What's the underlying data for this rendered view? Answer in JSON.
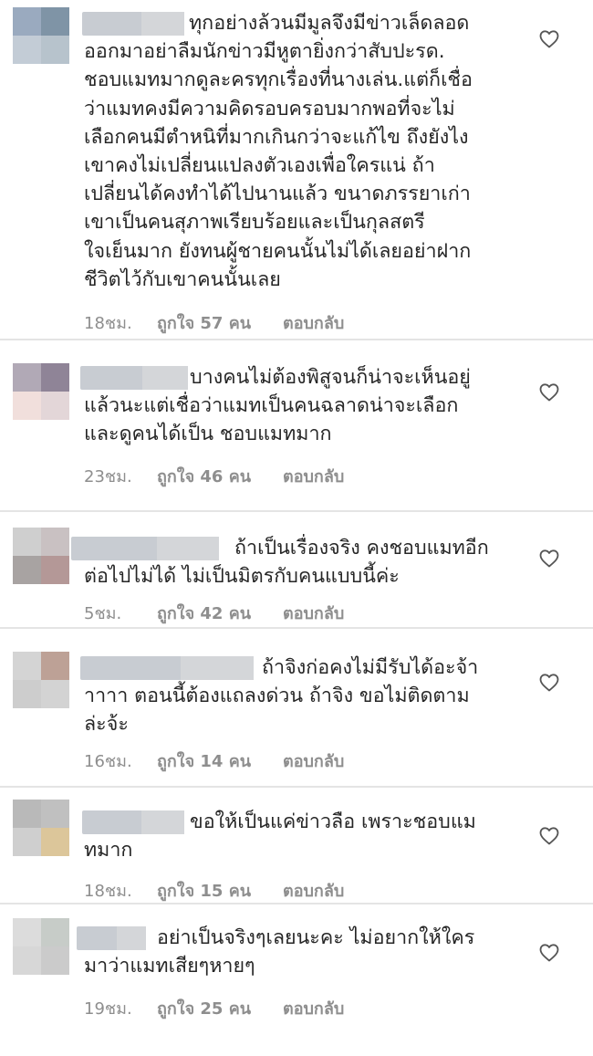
{
  "comments": [
    {
      "lines": [
        "ทุกอย่างล้วนมีมูลจึงมีข่าวเล็ดลอด",
        "ออกมาอย่าลืมนักข่าวมีหูตายิ่งกว่าสับปะรด.",
        "ชอบแมทมากดูละครทุกเรื่องที่นางเล่น.แต่ก็เชื่อ",
        "ว่าแมทคงมีความคิดรอบครอบมากพอที่จะไม่",
        "เลือกคนมีตำหนิที่มากเกินกว่าจะแก้ไข ถึงยังไง",
        "เขาคงไม่เปลี่ยนแปลงตัวเองเพื่อใครแน่ ถ้า",
        "เปลี่ยนได้คงทำได้ไปนานแล้ว ขนาดภรรยาเก่า",
        "เขาเป็นคนสุภาพเรียบร้อยและเป็นกุลสตรี",
        "ใจเย็นมาก ยังทนผู้ชายคนนั้นไม่ได้เลยอย่าฝาก",
        "ชีวิตไว้กับเขาคนนั้นเลย"
      ],
      "time": "18ชม.",
      "likes": "ถูกใจ 57 คน",
      "reply": "ตอบกลับ"
    },
    {
      "lines": [
        "บางคนไม่ต้องพิสูจนก็น่าจะเห็นอยู่",
        "แล้วนะแต่เชื่อว่าแมทเป็นคนฉลาดน่าจะเลือก",
        "และดูคนได้เป็น ชอบแมทมาก"
      ],
      "time": "23ชม.",
      "likes": "ถูกใจ 46 คน",
      "reply": "ตอบกลับ"
    },
    {
      "lines": [
        "ถ้าเป็นเรื่องจริง คงชอบแมทอีก",
        "ต่อไปไม่ได้ ไม่เป็นมิตรกับคนแบบนี้ค่ะ"
      ],
      "time": "5ชม.",
      "likes": "ถูกใจ 42 คน",
      "reply": "ตอบกลับ"
    },
    {
      "lines": [
        "ถ้าจิงก่อคงไม่มีรับได้อะจ้า",
        "าาาา ตอนนี้ต้องแถลงด่วน ถ้าจิง ขอไม่ติดตาม",
        "ล่ะจ้ะ"
      ],
      "time": "16ชม.",
      "likes": "ถูกใจ 14 คน",
      "reply": "ตอบกลับ"
    },
    {
      "lines": [
        "ขอให้เป็นแค่ข่าวลือ เพราะชอบแม",
        "ทมาก"
      ],
      "time": "18ชม.",
      "likes": "ถูกใจ 15 คน",
      "reply": "ตอบกลับ"
    },
    {
      "lines": [
        "อย่าเป็นจริงๆเลยนะคะ ไม่อยากให้ใคร",
        "มาว่าแมทเสียๆหายๆ"
      ],
      "time": "19ชม.",
      "likes": "ถูกใจ 25 คน",
      "reply": "ตอบกลับ"
    }
  ],
  "colors": {
    "text": "#262626",
    "meta": "#8e8e8e",
    "divider": "#e4e4e4",
    "blur": [
      "#c8ccd2",
      "#d4d6d9"
    ],
    "avatars": [
      [
        "#9aaabf",
        "#7f94a6",
        "#c3ccd6",
        "#b7c3cc"
      ],
      [
        "#b1a9b6",
        "#8f8497",
        "#f1dfdc",
        "#e3d6d8"
      ],
      [
        "#cfcfcf",
        "#c9c1c2",
        "#a8a3a2",
        "#b49897"
      ],
      [
        "#d4d4d4",
        "#bda196",
        "#cdcdcd",
        "#d3d3d3"
      ],
      [
        "#b9b9b9",
        "#c0c0c0",
        "#cfcfcf",
        "#dcc69a"
      ],
      [
        "#dcdcdc",
        "#c7ccc8",
        "#d7d7d7",
        "#cbcbcb"
      ]
    ]
  },
  "icons": {
    "like": "heart-outline-icon"
  }
}
